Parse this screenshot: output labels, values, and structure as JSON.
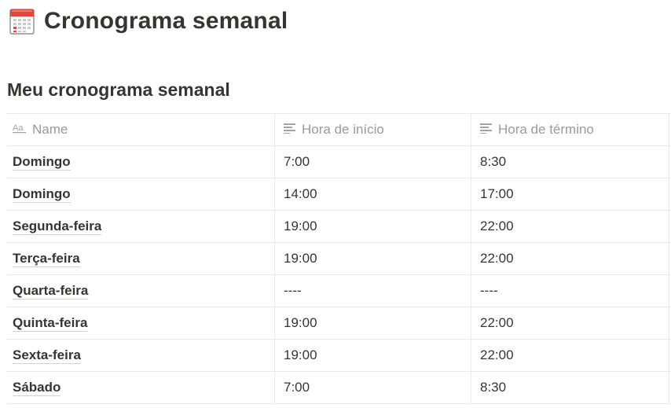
{
  "page": {
    "icon": "calendar-icon",
    "title": "Cronograma semanal"
  },
  "database": {
    "title": "Meu cronograma semanal",
    "columns": [
      {
        "label": "Name",
        "icon": "title-property-icon"
      },
      {
        "label": "Hora de início",
        "icon": "text-property-icon"
      },
      {
        "label": "Hora de término",
        "icon": "text-property-icon"
      }
    ],
    "rows": [
      {
        "name": "Domingo",
        "start": "7:00",
        "end": "8:30"
      },
      {
        "name": "Domingo",
        "start": "14:00",
        "end": "17:00"
      },
      {
        "name": "Segunda-feira",
        "start": "19:00",
        "end": "22:00"
      },
      {
        "name": "Terça-feira",
        "start": "19:00",
        "end": "22:00"
      },
      {
        "name": "Quarta-feira",
        "start": "----",
        "end": "----"
      },
      {
        "name": "Quinta-feira",
        "start": "19:00",
        "end": "22:00"
      },
      {
        "name": "Sexta-feira",
        "start": "19:00",
        "end": "22:00"
      },
      {
        "name": "Sábado",
        "start": "7:00",
        "end": "8:30"
      }
    ]
  },
  "colors": {
    "text": "#37352f",
    "muted": "#9b9a97",
    "border": "#e9e9e7",
    "calendar_red": "#e0463c"
  }
}
